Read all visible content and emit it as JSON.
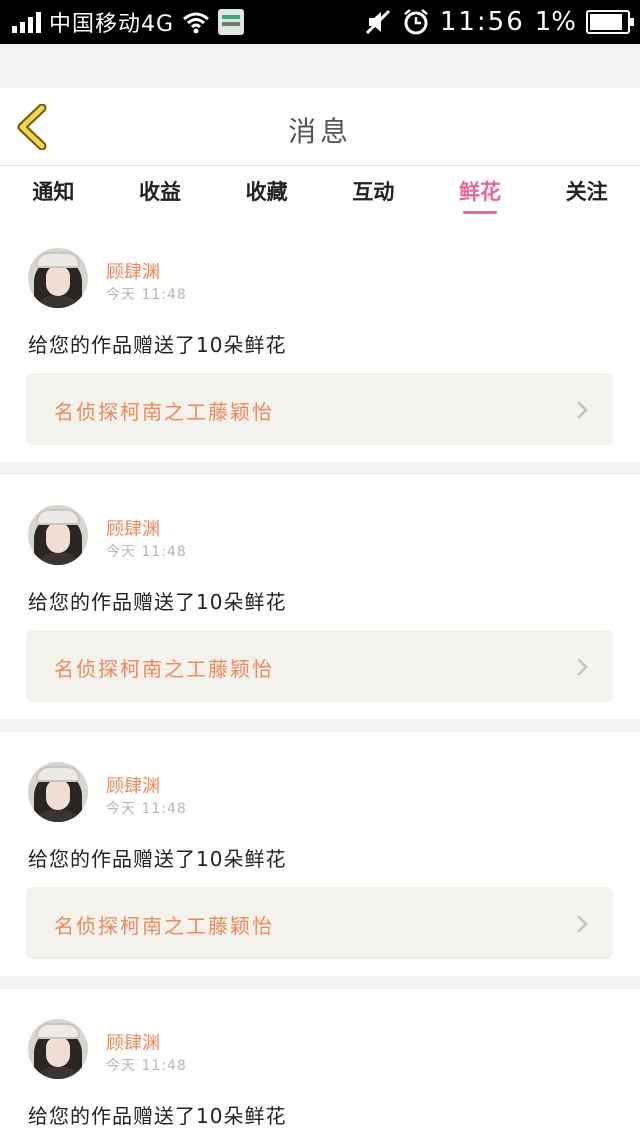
{
  "status_bar": {
    "carrier": "中国移动4G",
    "time": "11:56",
    "battery_percent": "1%",
    "battery_level": 0.9,
    "icons": [
      "signal-icon",
      "wifi-icon",
      "notification-icon",
      "mute-icon",
      "alarm-icon",
      "battery-icon"
    ]
  },
  "header": {
    "title": "消息",
    "back_icon": "chevron-left-icon",
    "accent_color": "#f0d64c"
  },
  "tabs": [
    {
      "label": "通知",
      "active": false
    },
    {
      "label": "收益",
      "active": false
    },
    {
      "label": "收藏",
      "active": false
    },
    {
      "label": "互动",
      "active": false
    },
    {
      "label": "鲜花",
      "active": true
    },
    {
      "label": "关注",
      "active": false
    }
  ],
  "colors": {
    "active_tab": "#e5689b",
    "username": "#f0885a",
    "work_title": "#f0885a",
    "link_bg": "#f3f2ec"
  },
  "messages": [
    {
      "user": "顾肆渊",
      "time": "今天 11:48",
      "text": "给您的作品赠送了10朵鲜花",
      "work": "名侦探柯南之工藤颖怡"
    },
    {
      "user": "顾肆渊",
      "time": "今天 11:48",
      "text": "给您的作品赠送了10朵鲜花",
      "work": "名侦探柯南之工藤颖怡"
    },
    {
      "user": "顾肆渊",
      "time": "今天 11:48",
      "text": "给您的作品赠送了10朵鲜花",
      "work": "名侦探柯南之工藤颖怡"
    },
    {
      "user": "顾肆渊",
      "time": "今天 11:48",
      "text": "给您的作品赠送了10朵鲜花"
    }
  ]
}
